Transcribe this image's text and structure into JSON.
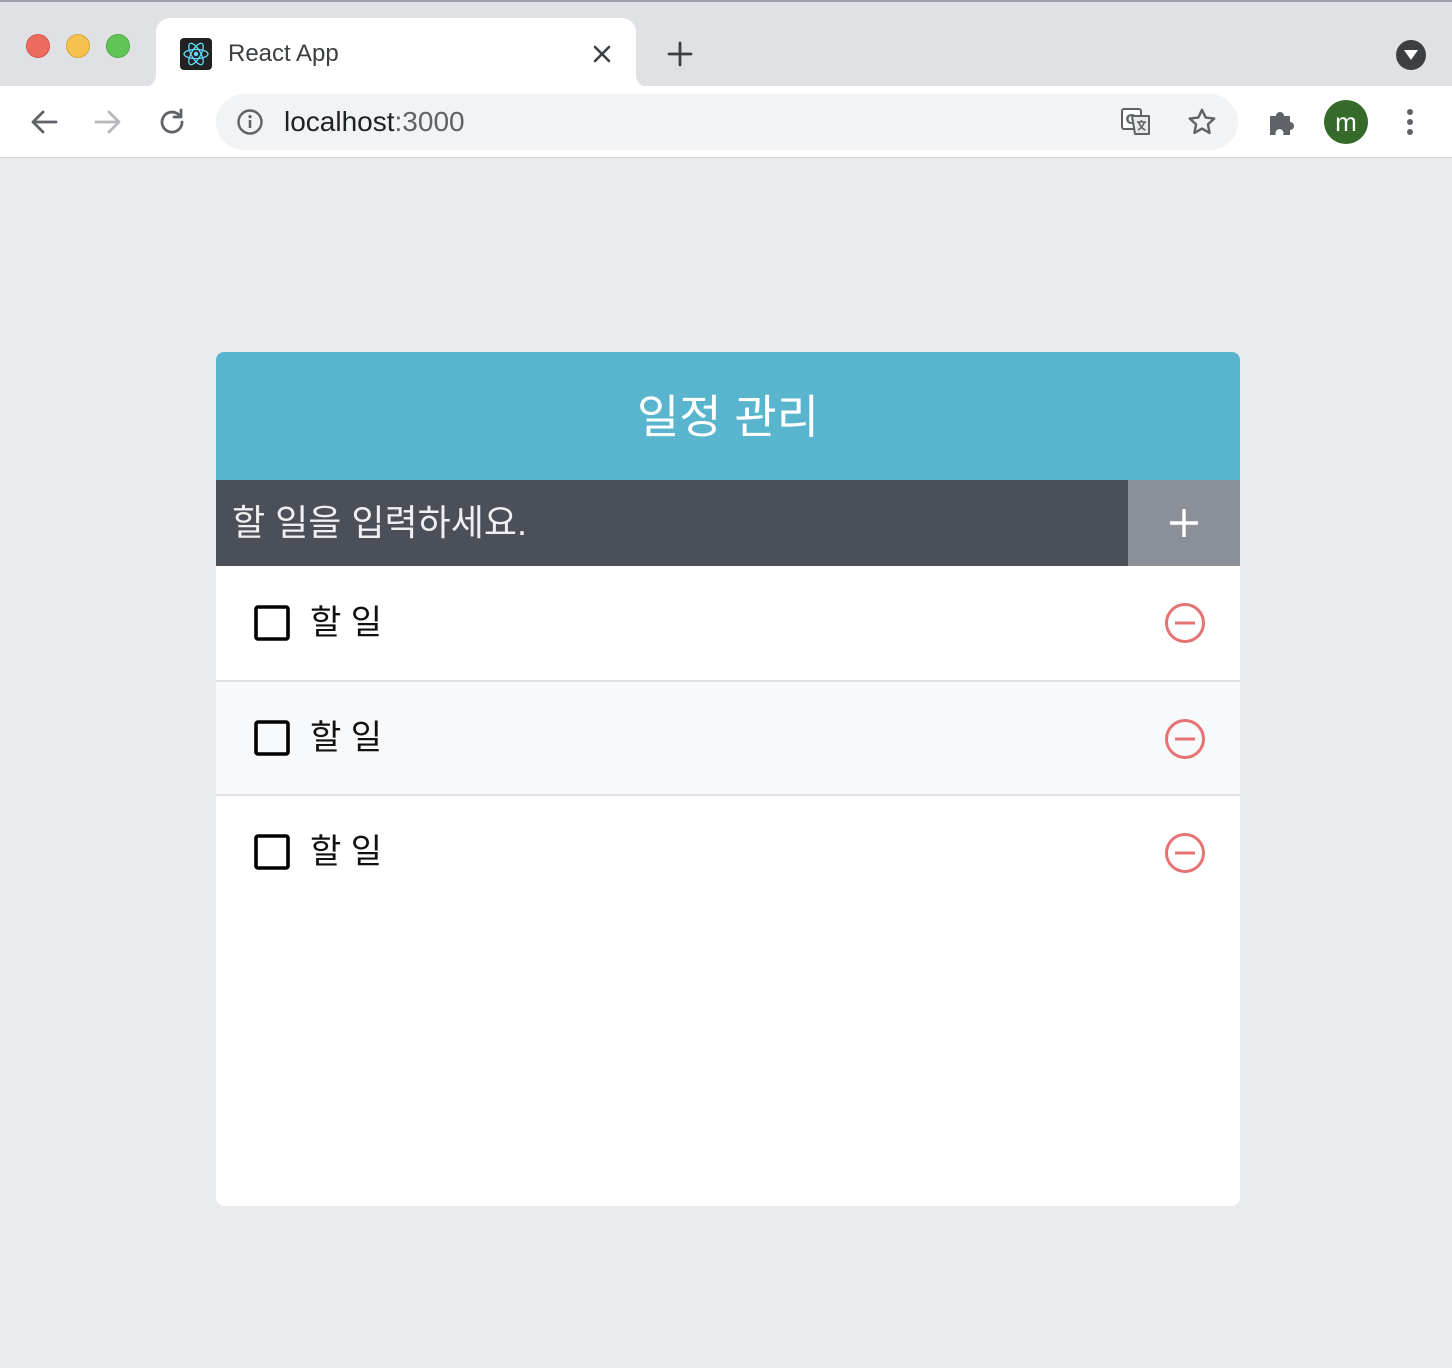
{
  "browser": {
    "tab": {
      "title": "React App",
      "favicon": "react-logo-icon"
    },
    "address_bar": {
      "host": "localhost",
      "port": ":3000"
    },
    "profile": {
      "initial": "m",
      "color": "#356a2a"
    },
    "icons": [
      "back-arrow-icon",
      "forward-arrow-icon",
      "reload-icon",
      "info-icon",
      "translate-icon",
      "star-icon",
      "extensions-puzzle-icon",
      "kebab-menu-icon",
      "close-icon",
      "plus-icon",
      "tab-search-icon"
    ]
  },
  "app": {
    "title": "일정 관리",
    "colors": {
      "header": "#58b5cd",
      "insert_bg": "#4b4f57",
      "insert_button": "#8b9098",
      "remove": "#e57373"
    },
    "insert": {
      "placeholder": "할 일을 입력하세요.",
      "value": ""
    },
    "todos": [
      {
        "text": "할 일",
        "checked": false
      },
      {
        "text": "할 일",
        "checked": false
      },
      {
        "text": "할 일",
        "checked": false
      }
    ]
  }
}
